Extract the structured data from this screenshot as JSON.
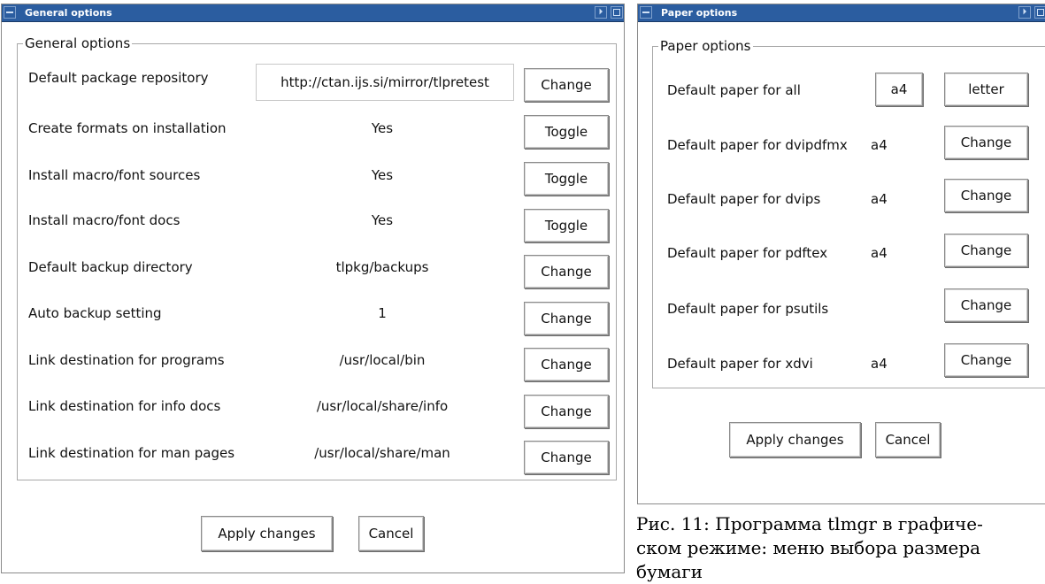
{
  "general_window": {
    "title": "General options",
    "group_label": "General options",
    "rows": [
      {
        "label": "Default package repository",
        "value": "http://ctan.ijs.si/mirror/tlpretest",
        "button": "Change"
      },
      {
        "label": "Create formats on installation",
        "value": "Yes",
        "button": "Toggle"
      },
      {
        "label": "Install macro/font sources",
        "value": "Yes",
        "button": "Toggle"
      },
      {
        "label": "Install macro/font docs",
        "value": "Yes",
        "button": "Toggle"
      },
      {
        "label": "Default backup directory",
        "value": "tlpkg/backups",
        "button": "Change"
      },
      {
        "label": "Auto backup setting",
        "value": "1",
        "button": "Change"
      },
      {
        "label": "Link destination for programs",
        "value": "/usr/local/bin",
        "button": "Change"
      },
      {
        "label": "Link destination for info docs",
        "value": "/usr/local/share/info",
        "button": "Change"
      },
      {
        "label": "Link destination for man pages",
        "value": "/usr/local/share/man",
        "button": "Change"
      }
    ],
    "apply_label": "Apply changes",
    "cancel_label": "Cancel"
  },
  "paper_window": {
    "title": "Paper options",
    "group_label": "Paper options",
    "all_row": {
      "label": "Default paper for all",
      "button_a4": "a4",
      "button_letter": "letter"
    },
    "rows": [
      {
        "label": "Default paper for dvipdfmx",
        "value": "a4",
        "button": "Change"
      },
      {
        "label": "Default paper for dvips",
        "value": "a4",
        "button": "Change"
      },
      {
        "label": "Default paper for pdftex",
        "value": "a4",
        "button": "Change"
      },
      {
        "label": "Default paper for psutils",
        "value": "",
        "button": "Change"
      },
      {
        "label": "Default paper for xdvi",
        "value": "a4",
        "button": "Change"
      }
    ],
    "apply_label": "Apply changes",
    "cancel_label": "Cancel"
  },
  "caption": {
    "line1": "Рис. 11: Программа tlmgr в графиче-",
    "line2": "ском режиме: меню выбора размера",
    "line3": "бумаги"
  },
  "colors": {
    "titlebar": "#2b5da0",
    "titlebar_text": "#ffffff"
  },
  "icons": {
    "window_menu": "window-menu-icon",
    "minimize": "minimize-icon",
    "maximize": "maximize-icon"
  }
}
